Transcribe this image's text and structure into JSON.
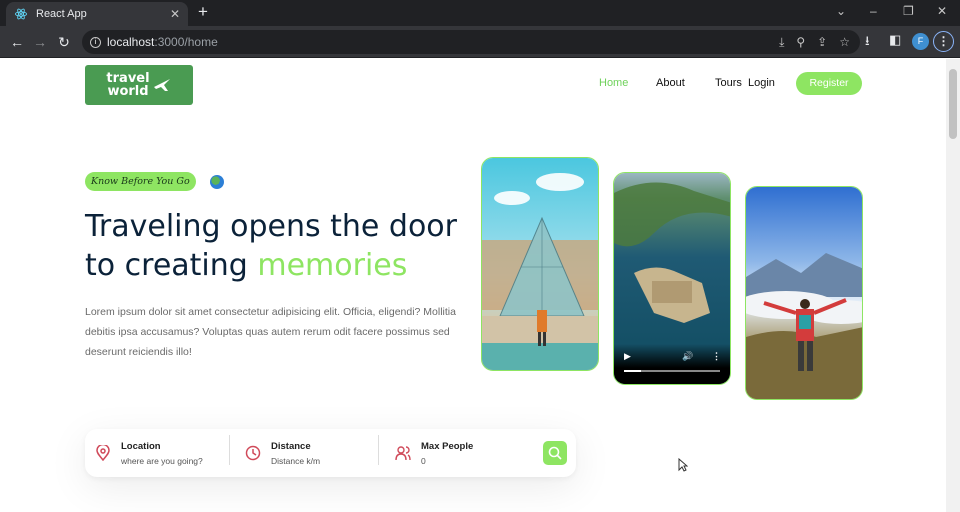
{
  "browser": {
    "tab_title": "React App",
    "url_host": "localhost",
    "url_path": ":3000/home",
    "profile_initial": "F"
  },
  "nav": {
    "logo_line1": "travel",
    "logo_line2": "world",
    "links": [
      "Home",
      "About",
      "Tours",
      "Login"
    ],
    "register": "Register"
  },
  "hero": {
    "tag": "Know Before You Go",
    "heading_line1": "Traveling opens the door",
    "heading_line2_prefix": "to creating ",
    "heading_highlight": "memories",
    "description": "Lorem ipsum dolor sit amet consectetur adipisicing elit. Officia, eligendi? Mollitia debitis ipsa accusamus? Voluptas quas autem rerum odit facere possimus sed deserunt reiciendis illo!"
  },
  "search": {
    "location_label": "Location",
    "location_placeholder": "where are you going?",
    "distance_label": "Distance",
    "distance_placeholder": "Distance k/m",
    "people_label": "Max People",
    "people_placeholder": "0"
  },
  "video": {
    "progress": 0.18
  },
  "colors": {
    "accent": "#8ee562",
    "heading": "#0b2239",
    "logo_bg": "#4a9b52"
  }
}
